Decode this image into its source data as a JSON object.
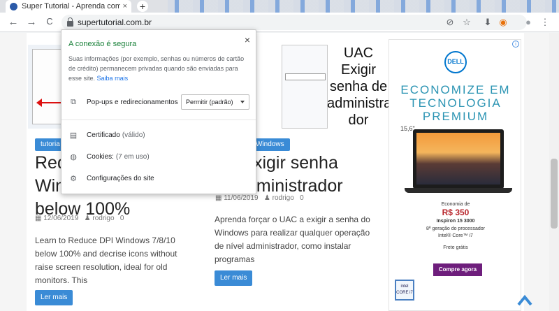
{
  "tab": {
    "title": "Super Tutorial - Aprenda com tu",
    "close": "×",
    "new": "+"
  },
  "toolbar": {
    "back": "←",
    "forward": "→",
    "reload": "C",
    "url": "supertutorial.com.br",
    "icons": {
      "extension": "⊘",
      "star": "☆",
      "download": "⬇",
      "profile_ext": "◉",
      "account": "●",
      "menu": "⋮"
    }
  },
  "popup": {
    "title": "A conexão é segura",
    "description": "Suas informações (por exemplo, senhas ou números de cartão de crédito) permanecem privadas quando são enviadas para esse site.",
    "learn_more": "Saiba mais",
    "close": "×",
    "popups_label": "Pop-ups e redirecionamentos",
    "popups_value": "Permitir (padrão)",
    "certificate_label": "Certificado",
    "certificate_sub": "(válido)",
    "cookies_label": "Cookies:",
    "cookies_sub": "(7 em uso)",
    "site_settings": "Configurações do site",
    "icons": {
      "popups": "external-link-icon",
      "certificate": "certificate-icon",
      "cookies": "cookie-icon",
      "settings": "gear-icon"
    }
  },
  "posts": [
    {
      "tag": "tutoria",
      "title_lines": [
        "Red",
        "Win",
        "below 100%"
      ],
      "date": "12/06/2019",
      "author": "rodrigo",
      "comments": "0",
      "excerpt_lines": [
        "Learn to Reduce DPI Windows 7/8/10",
        "below 100% and decrise icons without",
        "raise screen resolution, ideal for old",
        "monitors. This"
      ],
      "button": "Ler mais"
    },
    {
      "tag": "Windows",
      "thumb_text": [
        "UAC",
        "Exigir",
        "senha de",
        "administra",
        "dor"
      ],
      "title_lines": [
        "- Exigir senha",
        "dministrador"
      ],
      "date": "11/06/2019",
      "author": "rodrigo",
      "comments": "0",
      "excerpt_lines": [
        "Aprenda forçar o UAC a exigir a senha do",
        "Windows para realizar qualquer operação",
        "de nível administrador, como instalar",
        "programas"
      ],
      "button": "Ler mais"
    }
  ],
  "ad": {
    "brand": "DELL",
    "line1": "ECONOMIZE EM",
    "line2": "TECNOLOGIA",
    "line3": "PREMIUM",
    "size": "15,6\"",
    "economy": "Economia de",
    "price": "R$ 350",
    "model": "Inspiron 15 3000",
    "gen": "8ª geração do processador",
    "cpu": "Intel® Core™ i7",
    "shipping": "Frete grátis",
    "cta": "Compre agora",
    "badge": "intel CORE i7",
    "info": "i"
  }
}
